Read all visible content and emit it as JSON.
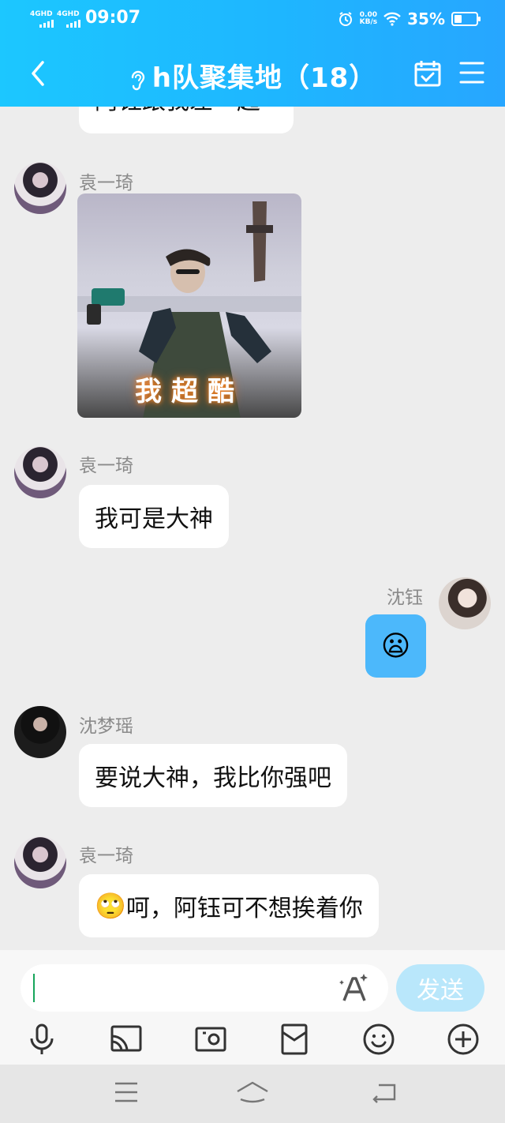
{
  "status_bar": {
    "sim1": "4GHD",
    "sim2": "4GHD",
    "time": "09:07",
    "net_speed_value": "0.00",
    "net_speed_unit": "KB/s",
    "battery_percent": "35%",
    "battery_level": 0.35
  },
  "header": {
    "title": "h队聚集地（18）"
  },
  "messages": {
    "partial_top_text": "阿钰跟我差一起",
    "m1": {
      "sender": "袁一琦",
      "image_caption": "我超酷"
    },
    "m2": {
      "sender": "袁一琦",
      "text": "我可是大神"
    },
    "m3": {
      "sender": "沈钰",
      "emoji": "😦"
    },
    "m4": {
      "sender": "沈梦瑶",
      "text": "要说大神，我比你强吧"
    },
    "m5": {
      "sender": "袁一琦",
      "emoji": "🙄",
      "text": "呵，阿钰可不想挨着你"
    }
  },
  "input": {
    "value": "",
    "send_label": "发送"
  },
  "colors": {
    "header_start": "#1cc7ff",
    "header_end": "#27a6ff",
    "self_bubble": "#4cb8fb",
    "send_button": "#b9e7fb",
    "caret": "#17a55b"
  },
  "icons": {
    "back": "chevron-left-icon",
    "ear": "ear-icon",
    "calendar": "calendar-check-icon",
    "menu": "hamburger-menu-icon",
    "font": "font-style-icon",
    "toolbar": [
      "microphone-icon",
      "screen-cast-icon",
      "photo-icon",
      "red-packet-icon",
      "smiley-icon",
      "plus-circle-icon"
    ],
    "nav": [
      "nav-menu-icon",
      "nav-home-icon",
      "nav-back-icon"
    ]
  }
}
